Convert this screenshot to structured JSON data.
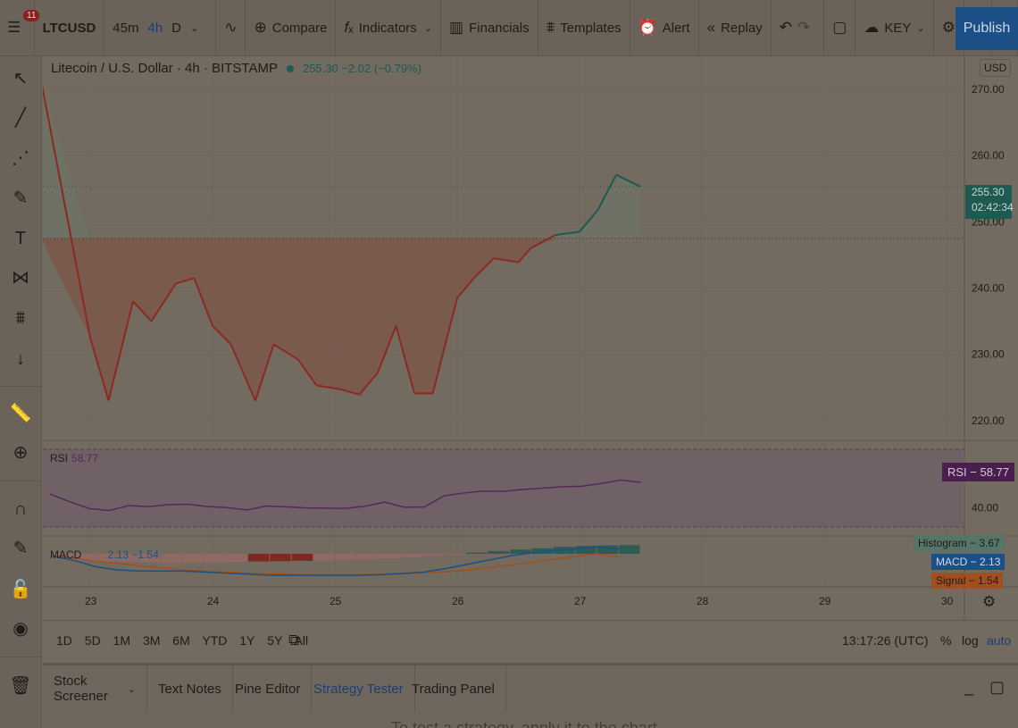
{
  "toolbar": {
    "notifications": "11",
    "symbol": "LTCUSD",
    "intervals": [
      "45m",
      "4h",
      "D"
    ],
    "active_interval": "4h",
    "compare": "Compare",
    "indicators": "Indicators",
    "financials": "Financials",
    "templates": "Templates",
    "alert": "Alert",
    "replay": "Replay",
    "layout_name": "KEY",
    "publish": "Publish"
  },
  "legend": {
    "title": "Litecoin / U.S. Dollar · 4h · BITSTAMP",
    "value": "255.30 −2.02 (−0.79%)"
  },
  "currency": "USD",
  "price_tag": {
    "price": "255.30",
    "countdown": "02:42:34"
  },
  "rsi": {
    "label": "RSI",
    "value": "58.77",
    "tag": "RSI − 58.77",
    "axis_label": "40.00"
  },
  "macd": {
    "label": "MACD",
    "values": "2.13 −1.54",
    "histogram_tag": "Histogram − 3.67",
    "macd_tag": "MACD − 2.13",
    "signal_tag": "Signal − 1.54"
  },
  "colors": {
    "up": "#1d5a52",
    "down": "#8a2a22",
    "rsi": "#54295a",
    "macd": "#1b4f86",
    "signal": "#a0501e",
    "accent": "#1b4f86"
  },
  "chart_data": {
    "type": "line",
    "x": [
      "22.6",
      "23.0",
      "23.15",
      "23.35",
      "23.5",
      "23.7",
      "23.85",
      "24.0",
      "24.15",
      "24.35",
      "24.5",
      "24.7",
      "24.85",
      "25.05",
      "25.2",
      "25.35",
      "25.5",
      "25.65",
      "25.8",
      "26.0",
      "26.15",
      "26.3",
      "26.5",
      "26.6",
      "26.8",
      "27.0",
      "27.15",
      "27.3",
      "27.5"
    ],
    "series": [
      {
        "values": [
          271.2,
          232.5,
          223,
          238,
          235,
          240.7,
          241.5,
          234.3,
          231.5,
          223,
          231.5,
          229.2,
          225.3,
          224.7,
          223.9,
          227.2,
          234.3,
          224.1,
          224.1,
          238.5,
          241.8,
          244.5,
          243.9,
          246,
          248,
          248.5,
          251.8,
          257.1,
          255.3
        ]
      }
    ],
    "y_ticks": [
      "270.00",
      "260.00",
      "250.00",
      "240.00",
      "230.00",
      "220.00"
    ],
    "x_ticks": [
      "23",
      "24",
      "25",
      "26",
      "27",
      "28",
      "29",
      "30"
    ],
    "ylim": [
      217,
      275
    ],
    "baseline": 247.5,
    "rsi_values": [
      47,
      43,
      39.5,
      38.5,
      41,
      40.5,
      41.5,
      41.7,
      40.5,
      40,
      38.8,
      40.8,
      40.4,
      39.8,
      39.7,
      39.6,
      40.7,
      42.8,
      40.2,
      40.3,
      46,
      47.5,
      48.5,
      48.4,
      49.3,
      50,
      50.7,
      51,
      52.4,
      54.2,
      53
    ]
  },
  "bottom": {
    "ranges": [
      "1D",
      "5D",
      "1M",
      "3M",
      "6M",
      "YTD",
      "1Y",
      "5Y",
      "All"
    ],
    "time": "13:17:26 (UTC)",
    "pct": "%",
    "log": "log",
    "auto": "auto",
    "tabs": [
      "Stock Screener",
      "Text Notes",
      "Pine Editor",
      "Strategy Tester",
      "Trading Panel"
    ],
    "active_tab": "Strategy Tester",
    "message": "To test a strategy, apply it to the chart"
  }
}
